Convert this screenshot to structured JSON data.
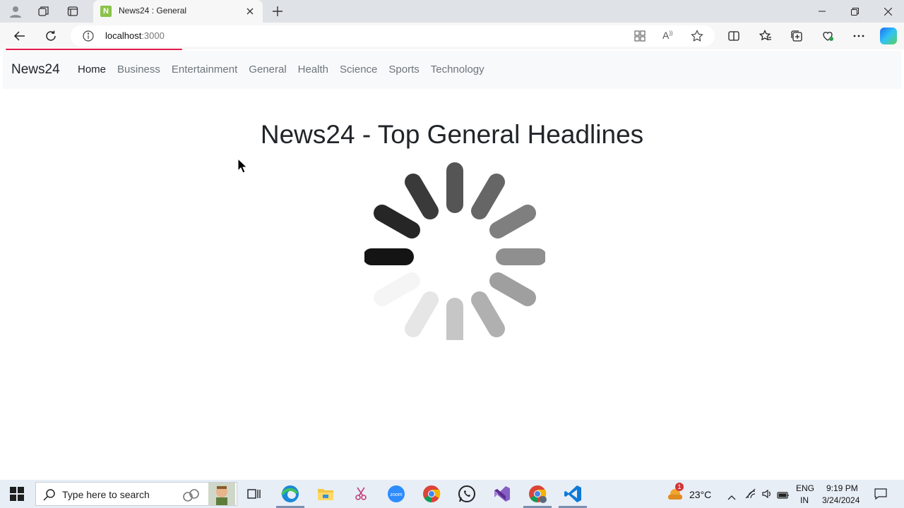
{
  "browser": {
    "tab_title": "News24 : General",
    "tab_favicon_letter": "N",
    "url_host": "localhost",
    "url_port": ":3000"
  },
  "page": {
    "brand": "News24",
    "nav_items": [
      "Home",
      "Business",
      "Entertainment",
      "General",
      "Health",
      "Science",
      "Sports",
      "Technology"
    ],
    "active_nav": "Home",
    "headline": "News24 - Top General Headlines"
  },
  "taskbar": {
    "search_placeholder": "Type here to search",
    "weather_temp": "23°C",
    "weather_badge": "1",
    "language_1": "ENG",
    "language_2": "IN",
    "time": "9:19 PM",
    "date": "3/24/2024"
  },
  "colors": {
    "loading_bar": "#e6194b",
    "navbar_bg": "#f8f9fa",
    "active_link": "#212529",
    "inactive_link": "#6c757d"
  }
}
